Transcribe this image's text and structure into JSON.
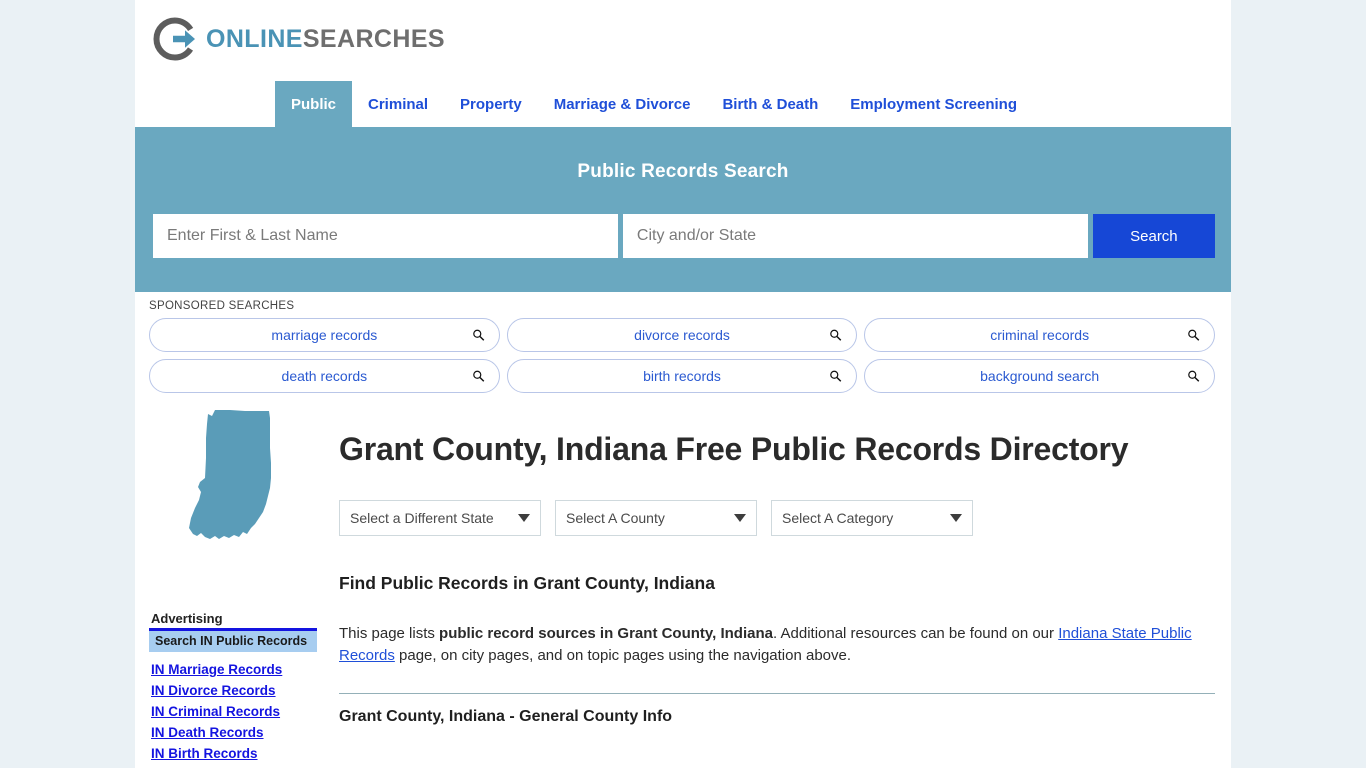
{
  "brand": {
    "logo_icon": "circle-arrow-icon",
    "name_part1": "ONLINE",
    "name_part2": "SEARCHES"
  },
  "nav": {
    "items": [
      {
        "label": "Public",
        "active": true
      },
      {
        "label": "Criminal",
        "active": false
      },
      {
        "label": "Property",
        "active": false
      },
      {
        "label": "Marriage & Divorce",
        "active": false
      },
      {
        "label": "Birth & Death",
        "active": false
      },
      {
        "label": "Employment Screening",
        "active": false
      }
    ]
  },
  "banner": {
    "title": "Public Records Search",
    "name_placeholder": "Enter First & Last Name",
    "name_value": "",
    "city_placeholder": "City and/or State",
    "city_value": "",
    "search_button": "Search"
  },
  "sponsored": {
    "label": "SPONSORED SEARCHES",
    "rows": [
      [
        {
          "label": "marriage records",
          "icon": "search-icon"
        },
        {
          "label": "divorce records",
          "icon": "search-icon"
        },
        {
          "label": "criminal records",
          "icon": "search-icon"
        }
      ],
      [
        {
          "label": "death records",
          "icon": "search-icon"
        },
        {
          "label": "birth records",
          "icon": "search-icon"
        },
        {
          "label": "background search",
          "icon": "search-icon"
        }
      ]
    ]
  },
  "sidebar": {
    "state_map_icon": "indiana-state-map-icon",
    "ad_heading": "Advertising",
    "ad_box_title": "Search IN Public Records",
    "ad_links": [
      {
        "label": "IN Marriage Records"
      },
      {
        "label": "IN Divorce Records"
      },
      {
        "label": "IN Criminal Records"
      },
      {
        "label": "IN Death Records"
      },
      {
        "label": "IN Birth Records"
      }
    ]
  },
  "main": {
    "page_title": "Grant County, Indiana Free Public Records Directory",
    "selects": [
      {
        "label": "Select a Different State"
      },
      {
        "label": "Select A County"
      },
      {
        "label": "Select A Category"
      }
    ],
    "section_heading": "Find Public Records in Grant County, Indiana",
    "paragraph": {
      "part1": "This page lists ",
      "bold1": "public record sources in Grant County, Indiana",
      "part2": ". Additional resources can be found on our ",
      "link1": "Indiana State Public Records",
      "part3": " page, on city pages, and on topic pages using the navigation above."
    },
    "subsection_heading": "Grant County, Indiana - General County Info"
  },
  "colors": {
    "page_background": "#eaf1f5",
    "banner": "#6aa8c0",
    "search_button": "#1647d6",
    "link_blue": "#1f4fd8",
    "logo_blue": "#4a93b5",
    "logo_gray": "#6e6e6e",
    "ad_box": "#a7cdf0",
    "ad_border": "#1414e0",
    "state_map": "#5a9cb8"
  }
}
